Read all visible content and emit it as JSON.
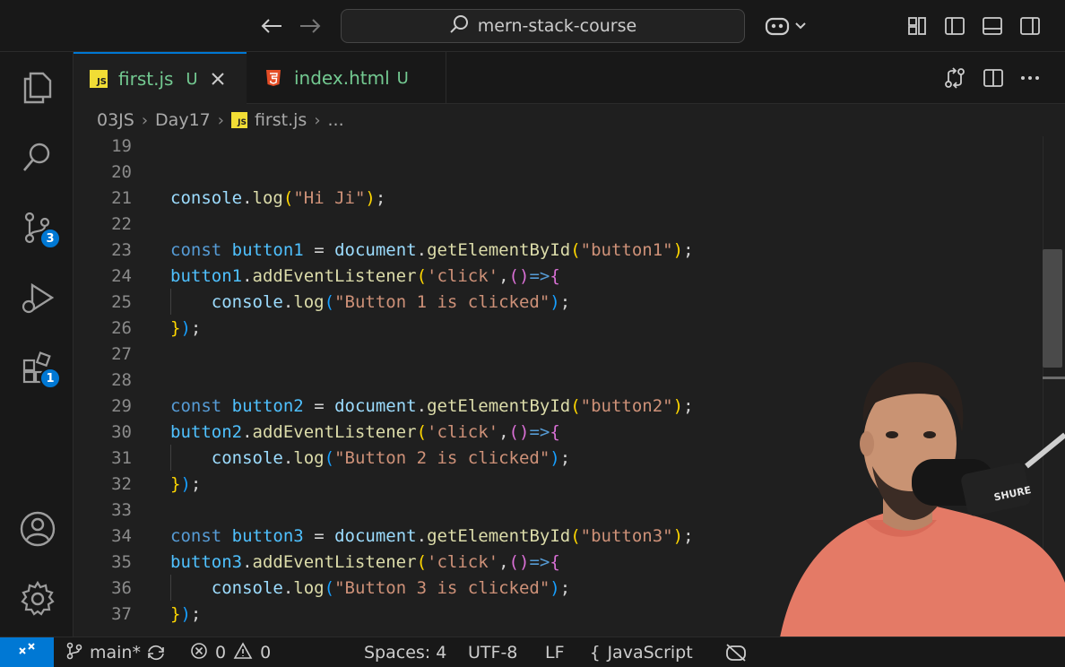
{
  "titlebar": {
    "search_text": "mern-stack-course"
  },
  "activity": {
    "source_control_badge": "3",
    "extensions_badge": "1"
  },
  "tabs": [
    {
      "label": "first.js",
      "status": "U",
      "icon": "js-file-icon"
    },
    {
      "label": "index.html",
      "status": "U",
      "icon": "html-file-icon"
    }
  ],
  "breadcrumb": {
    "items": [
      "03JS",
      "Day17",
      "first.js",
      "..."
    ]
  },
  "editor": {
    "lines": [
      {
        "num": "19",
        "text": ""
      },
      {
        "num": "20",
        "text": ""
      },
      {
        "num": "21",
        "text": "console.log(\"Hi Ji\");"
      },
      {
        "num": "22",
        "text": ""
      },
      {
        "num": "23",
        "text": "const button1 = document.getElementById(\"button1\");"
      },
      {
        "num": "24",
        "text": "button1.addEventListener('click',()=>{"
      },
      {
        "num": "25",
        "text": "    console.log(\"Button 1 is clicked\");"
      },
      {
        "num": "26",
        "text": "});"
      },
      {
        "num": "27",
        "text": ""
      },
      {
        "num": "28",
        "text": ""
      },
      {
        "num": "29",
        "text": "const button2 = document.getElementById(\"button2\");"
      },
      {
        "num": "30",
        "text": "button2.addEventListener('click',()=>{"
      },
      {
        "num": "31",
        "text": "    console.log(\"Button 2 is clicked\");"
      },
      {
        "num": "32",
        "text": "});"
      },
      {
        "num": "33",
        "text": ""
      },
      {
        "num": "34",
        "text": "const button3 = document.getElementById(\"button3\");"
      },
      {
        "num": "35",
        "text": "button3.addEventListener('click',()=>{"
      },
      {
        "num": "36",
        "text": "    console.log(\"Button 3 is clicked\");"
      },
      {
        "num": "37",
        "text": "});"
      }
    ]
  },
  "statusbar": {
    "branch": "main*",
    "errors": "0",
    "warnings": "0",
    "spaces": "Spaces: 4",
    "encoding": "UTF-8",
    "eol": "LF",
    "language": "JavaScript"
  },
  "colors": {
    "accent": "#0078d4",
    "untracked": "#73c991",
    "js_icon": "#f1dd35",
    "html_icon": "#e44d26"
  }
}
